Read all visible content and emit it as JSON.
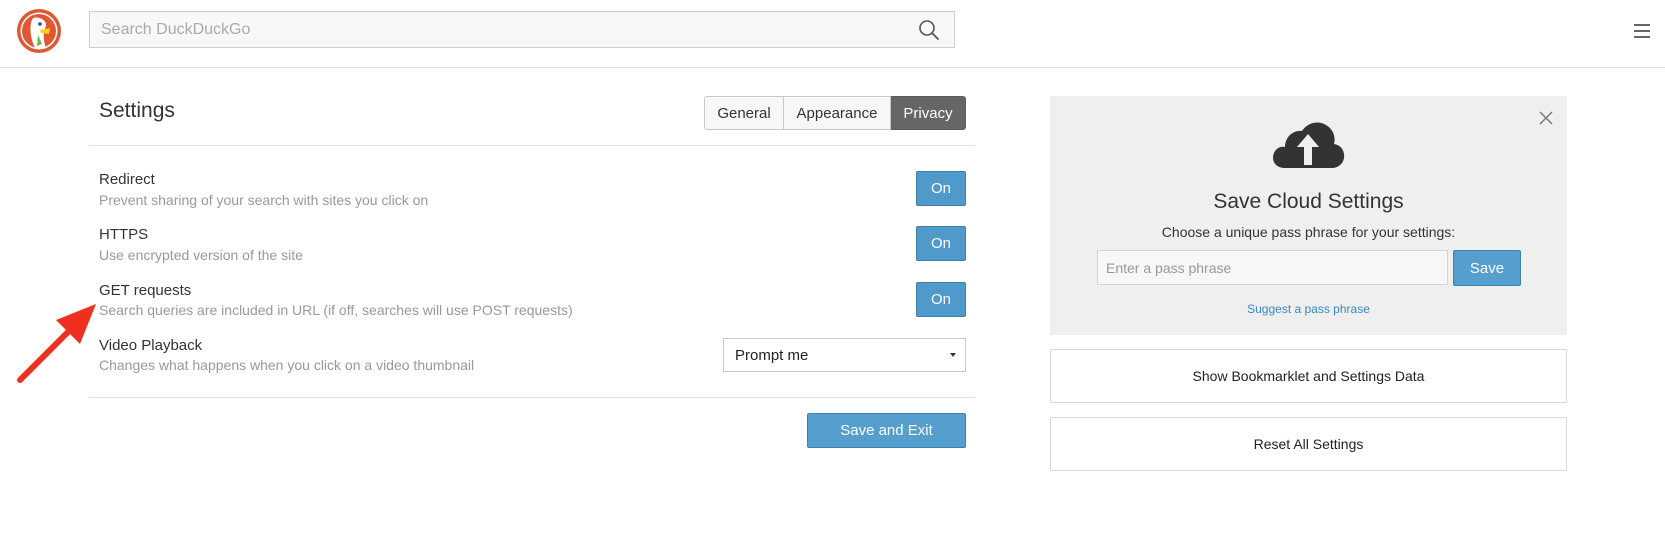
{
  "search": {
    "placeholder": "Search DuckDuckGo"
  },
  "settings": {
    "title": "Settings",
    "tabs": [
      {
        "label": "General",
        "active": false
      },
      {
        "label": "Appearance",
        "active": false
      },
      {
        "label": "Privacy",
        "active": true
      }
    ],
    "items": [
      {
        "label": "Redirect",
        "description": "Prevent sharing of your search with sites you click on",
        "toggle": "On"
      },
      {
        "label": "HTTPS",
        "description": "Use encrypted version of the site",
        "toggle": "On"
      },
      {
        "label": "GET requests",
        "description": "Search queries are included in URL (if off, searches will use POST requests)",
        "toggle": "On"
      }
    ],
    "video": {
      "label": "Video Playback",
      "description": "Changes what happens when you click on a video thumbnail",
      "selected": "Prompt me"
    },
    "save_exit_label": "Save and Exit"
  },
  "cloud": {
    "title": "Save Cloud Settings",
    "subtitle": "Choose a unique pass phrase for your settings:",
    "pass_placeholder": "Enter a pass phrase",
    "save_label": "Save",
    "suggest_label": "Suggest a pass phrase",
    "bookmarklet_label": "Show Bookmarklet and Settings Data",
    "reset_label": "Reset All Settings"
  },
  "colors": {
    "accent_blue": "#4f9acb",
    "active_tab": "#666666",
    "annotation_red": "#f0301e",
    "logo_orange": "#de5833"
  },
  "icons": [
    "duckduckgo-logo",
    "search-icon",
    "hamburger-menu-icon",
    "close-icon",
    "cloud-upload-icon",
    "annotation-arrow",
    "chevron-down-icon"
  ]
}
